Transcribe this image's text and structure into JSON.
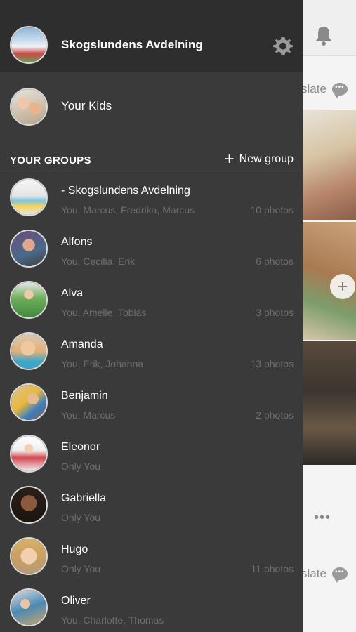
{
  "header": {
    "title": "Skogslundens Avdelning",
    "avatar_icon": "school-building-photo",
    "settings_icon": "gear-icon"
  },
  "kids": {
    "label": "Your Kids",
    "avatar_icon": "kids-photo"
  },
  "groups": {
    "section_title": "YOUR GROUPS",
    "new_group_label": "New group",
    "items": [
      {
        "name": "- Skogslundens Avdelning",
        "members": "You, Marcus, Fredrika, Marcus",
        "photos": "10 photos"
      },
      {
        "name": "Alfons",
        "members": "You, Cecilia, Erik",
        "photos": "6 photos"
      },
      {
        "name": "Alva",
        "members": "You, Amelie, Tobias",
        "photos": "3 photos"
      },
      {
        "name": "Amanda",
        "members": "You, Erik, Johanna",
        "photos": "13 photos"
      },
      {
        "name": "Benjamin",
        "members": "You, Marcus",
        "photos": "2 photos"
      },
      {
        "name": "Eleonor",
        "members": "Only You",
        "photos": ""
      },
      {
        "name": "Gabriella",
        "members": "Only You",
        "photos": ""
      },
      {
        "name": "Hugo",
        "members": "Only You",
        "photos": "11 photos"
      },
      {
        "name": "Oliver",
        "members": "You, Charlotte, Thomas",
        "photos": ""
      }
    ]
  },
  "background": {
    "translate_label": "slate",
    "bubble_dots": "•••",
    "more_dots": "•••",
    "add_icon": "plus-icon",
    "bell_icon": "bell-icon"
  },
  "colors": {
    "drawer_bg": "#3a3a3a",
    "drawer_header_bg": "#2e2e2e",
    "secondary_text": "#6e6e6e",
    "primary_text": "#ffffff"
  }
}
